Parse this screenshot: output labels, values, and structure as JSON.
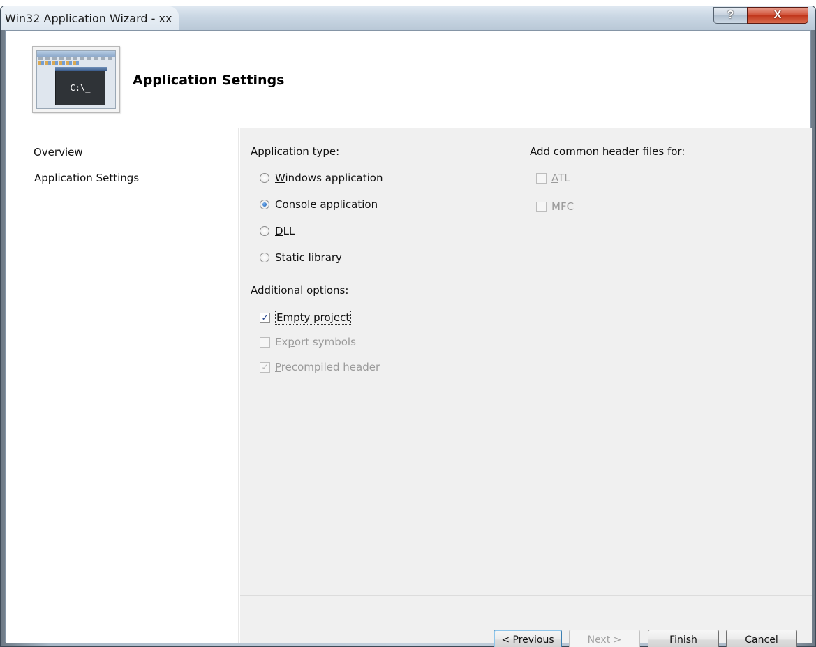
{
  "window": {
    "title": "Win32 Application Wizard - xx",
    "help_glyph": "?",
    "close_glyph": "X"
  },
  "header": {
    "title": "Application Settings",
    "icon_prompt": "C:\\_"
  },
  "sidebar": {
    "items": [
      {
        "label": "Overview",
        "selected": false
      },
      {
        "label": "Application Settings",
        "selected": true
      }
    ]
  },
  "app_type": {
    "heading": "Application type:",
    "options": [
      {
        "pre": "",
        "key": "W",
        "post": "indows application",
        "selected": false
      },
      {
        "pre": "C",
        "key": "o",
        "post": "nsole application",
        "selected": true
      },
      {
        "pre": "",
        "key": "D",
        "post": "LL",
        "selected": false
      },
      {
        "pre": "",
        "key": "S",
        "post": "tatic library",
        "selected": false
      }
    ]
  },
  "additional": {
    "heading": "Additional options:",
    "options": [
      {
        "key": "E",
        "post": "mpty project",
        "checked": true,
        "enabled": true
      },
      {
        "key": "E",
        "post": "x",
        "mid_key": "p",
        "post2": "ort symbols",
        "checked": false,
        "enabled": false
      },
      {
        "key": "P",
        "post": "recompiled header",
        "checked": true,
        "enabled": false
      }
    ]
  },
  "common_headers": {
    "heading": "Add common header files for:",
    "options": [
      {
        "key": "A",
        "post": "TL",
        "checked": false,
        "enabled": false
      },
      {
        "key": "M",
        "post": "FC",
        "checked": false,
        "enabled": false
      }
    ]
  },
  "buttons": {
    "previous": "< Previous",
    "next": "Next >",
    "finish": "Finish",
    "cancel": "Cancel"
  },
  "glyphs": {
    "check_mark": "✓"
  },
  "colors": {
    "content_bg": "#f0f0f0",
    "close_red": "#c0341a",
    "disabled_text": "#9a9a9a"
  }
}
